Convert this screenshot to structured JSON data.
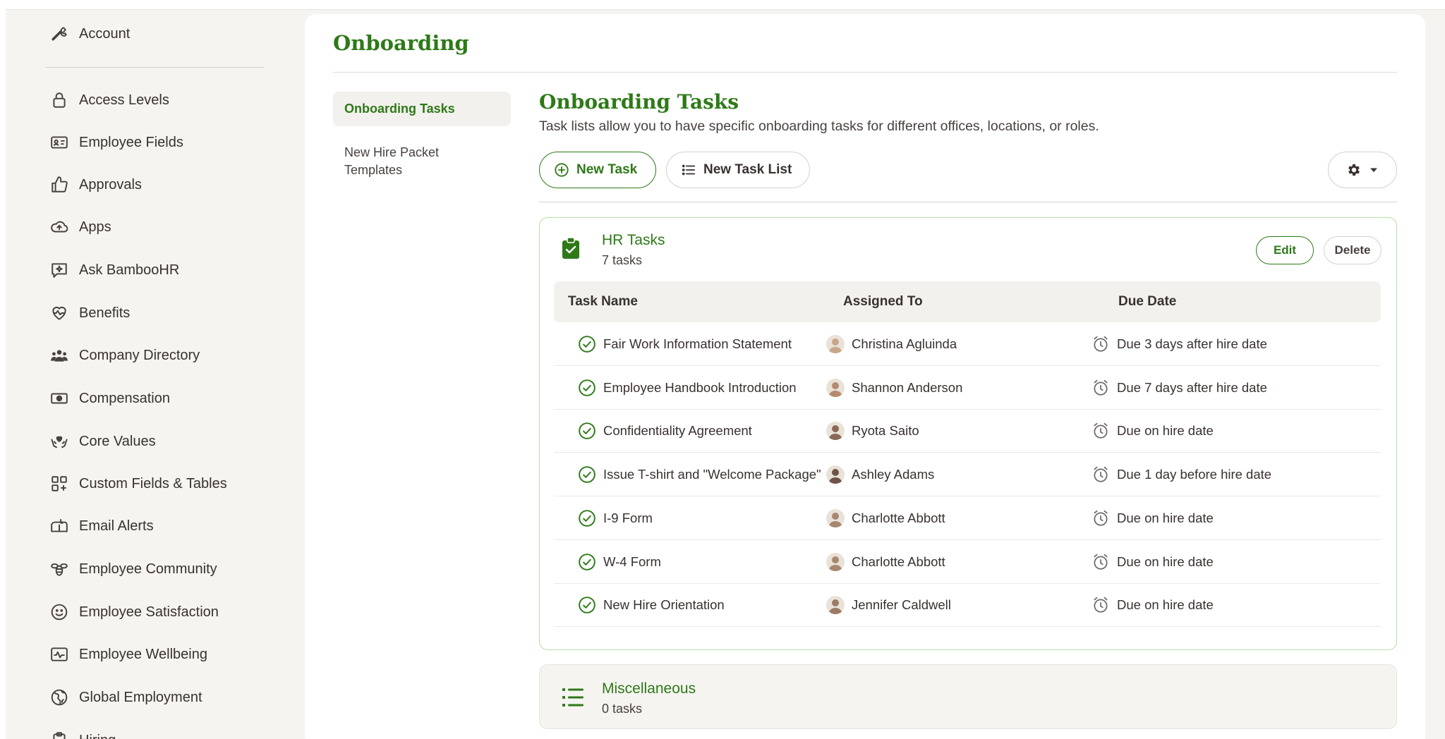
{
  "colors": {
    "brand": "#2e7918",
    "border_green": "#b6e0a7",
    "text": "#38312f",
    "muted_bg": "#f2f1ee"
  },
  "sidebar": {
    "account": {
      "label": "Account",
      "icon": "wrench-icon"
    },
    "items": [
      {
        "label": "Access Levels",
        "icon": "lock-icon"
      },
      {
        "label": "Employee Fields",
        "icon": "id-card-icon"
      },
      {
        "label": "Approvals",
        "icon": "thumbs-up-icon"
      },
      {
        "label": "Apps",
        "icon": "cloud-upload-icon"
      },
      {
        "label": "Ask BambooHR",
        "icon": "chat-sparkle-icon"
      },
      {
        "label": "Benefits",
        "icon": "heart-pulse-icon"
      },
      {
        "label": "Company Directory",
        "icon": "people-icon"
      },
      {
        "label": "Compensation",
        "icon": "money-icon"
      },
      {
        "label": "Core Values",
        "icon": "hands-heart-icon"
      },
      {
        "label": "Custom Fields & Tables",
        "icon": "grid-plus-icon"
      },
      {
        "label": "Email Alerts",
        "icon": "mailbox-icon"
      },
      {
        "label": "Employee Community",
        "icon": "bee-icon"
      },
      {
        "label": "Employee Satisfaction",
        "icon": "smile-icon"
      },
      {
        "label": "Employee Wellbeing",
        "icon": "wellbeing-icon"
      },
      {
        "label": "Global Employment",
        "icon": "globe-icon"
      },
      {
        "label": "Hiring",
        "icon": "clipboard-icon"
      }
    ]
  },
  "main": {
    "title": "Onboarding",
    "subnav": [
      {
        "label": "Onboarding Tasks",
        "active": true
      },
      {
        "label": "New Hire Packet Templates",
        "active": false
      }
    ],
    "section": {
      "title": "Onboarding Tasks",
      "description": "Task lists allow you to have specific onboarding tasks for different offices, locations, or roles."
    },
    "toolbar": {
      "new_task_label": "New Task",
      "new_task_list_label": "New Task List",
      "settings_icon": "gear-icon"
    },
    "task_lists": [
      {
        "name": "HR Tasks",
        "count": "7 tasks",
        "edit_label": "Edit",
        "delete_label": "Delete",
        "columns": [
          "Task Name",
          "Assigned To",
          "Due Date"
        ],
        "rows": [
          {
            "task": "Fair Work Information Statement",
            "assignee": "Christina Agluinda",
            "due": "Due 3 days after hire date"
          },
          {
            "task": "Employee Handbook Introduction",
            "assignee": "Shannon Anderson",
            "due": "Due 7 days after hire date"
          },
          {
            "task": "Confidentiality Agreement",
            "assignee": "Ryota Saito",
            "due": "Due on hire date"
          },
          {
            "task": "Issue T-shirt and \"Welcome Package\"",
            "assignee": "Ashley Adams",
            "due": "Due 1 day before hire date"
          },
          {
            "task": "I-9 Form",
            "assignee": "Charlotte Abbott",
            "due": "Due on hire date"
          },
          {
            "task": "W-4 Form",
            "assignee": "Charlotte Abbott",
            "due": "Due on hire date"
          },
          {
            "task": "New Hire Orientation",
            "assignee": "Jennifer Caldwell",
            "due": "Due on hire date"
          }
        ]
      },
      {
        "name": "Miscellaneous",
        "count": "0 tasks"
      }
    ]
  }
}
